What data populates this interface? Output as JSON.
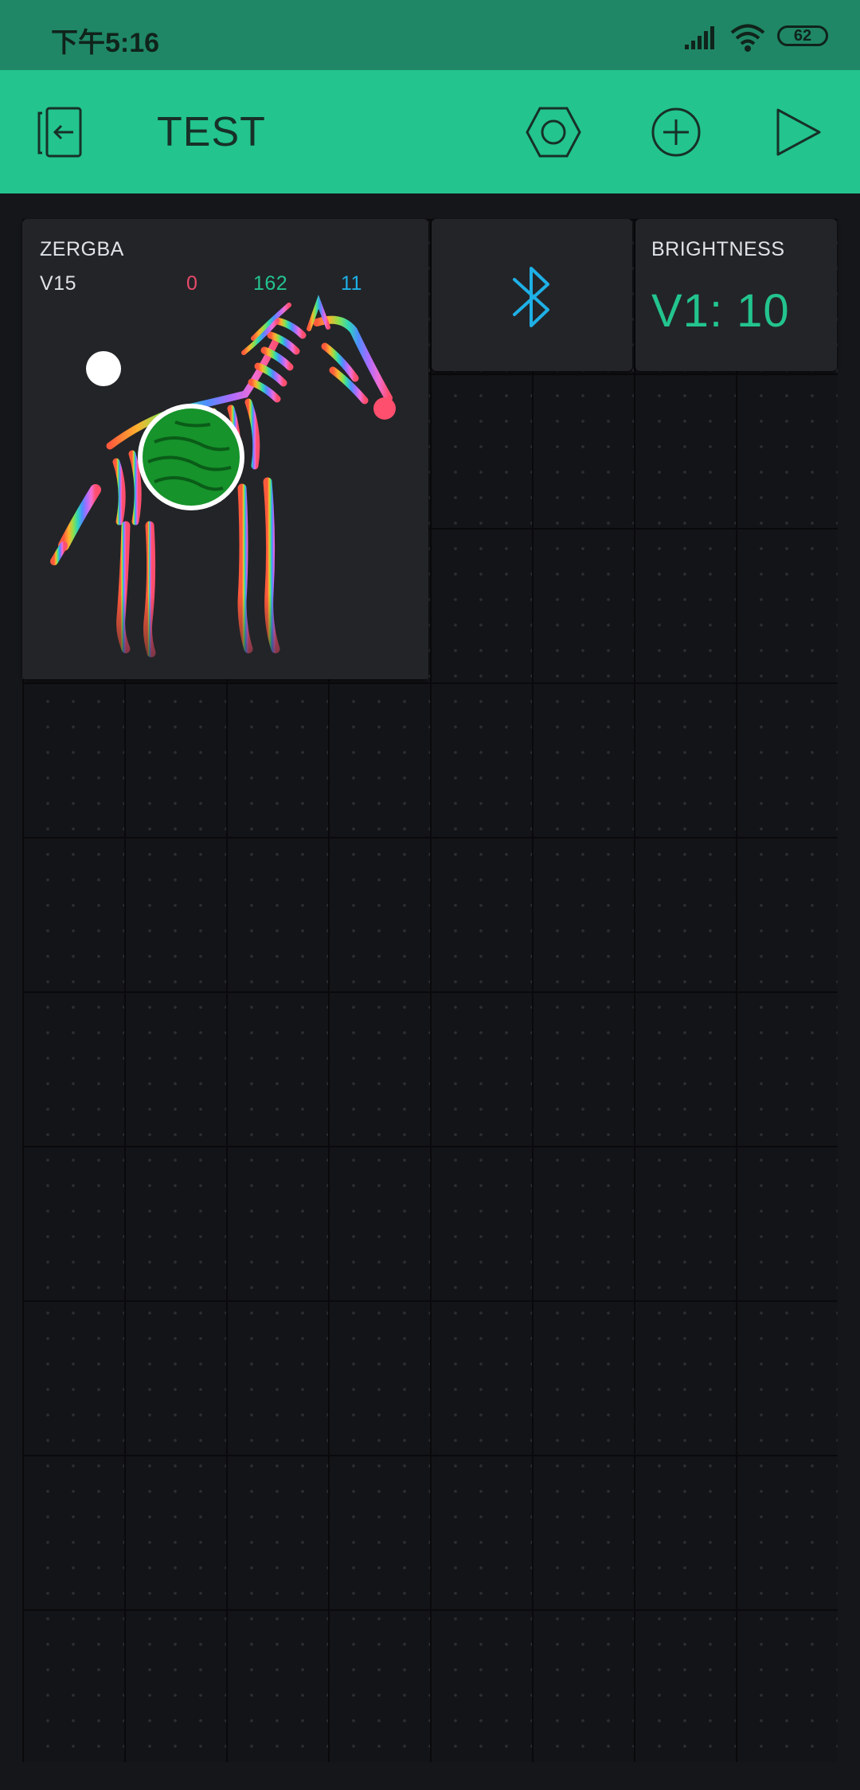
{
  "status_bar": {
    "time": "下午5:16",
    "battery": "62"
  },
  "app_bar": {
    "title": "TEST"
  },
  "zergba": {
    "title": "ZERGBA",
    "pin": "V15",
    "r": "0",
    "g": "162",
    "b": "11",
    "colors": {
      "r": "#e84b6a",
      "g": "#23c48e",
      "b": "#1eb0e6",
      "selected": "#16932b"
    }
  },
  "bluetooth": {
    "icon": "bluetooth-icon",
    "color": "#1eb0e6"
  },
  "brightness": {
    "title": "BRIGHTNESS",
    "value": "V1: 10",
    "color": "#23c48e"
  }
}
